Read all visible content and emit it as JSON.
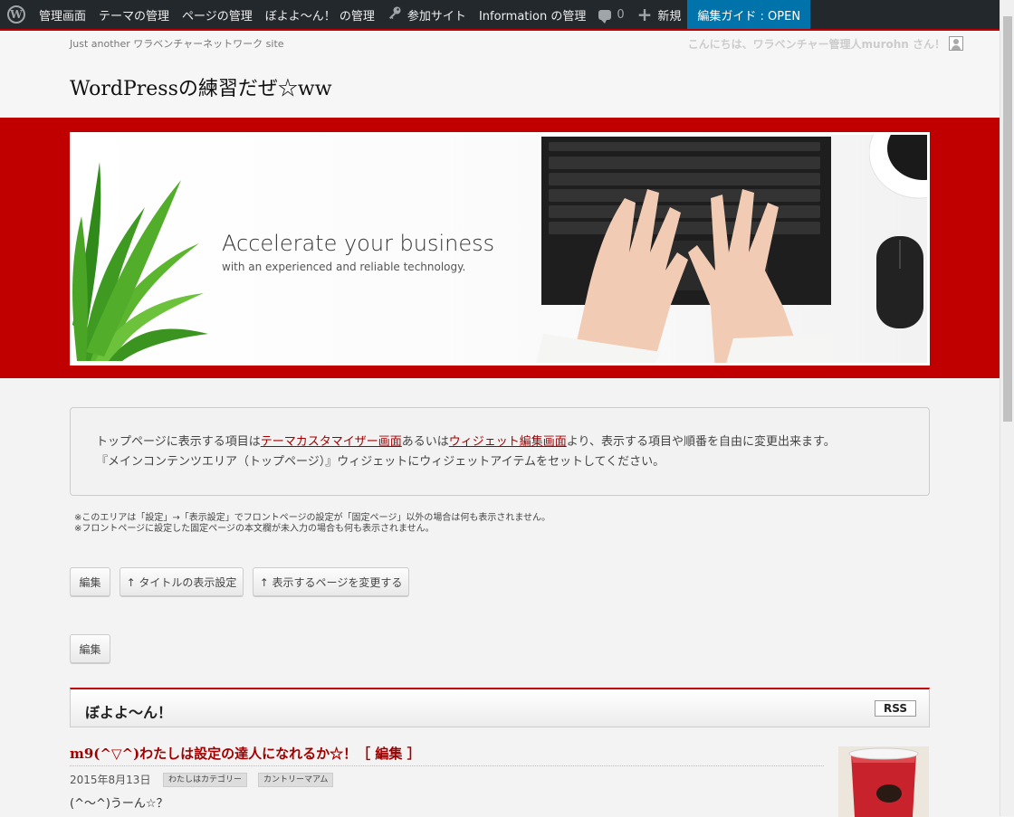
{
  "adminbar": {
    "items": [
      {
        "label": "管理画面",
        "icon": "dashboard-icon"
      },
      {
        "label": "テーマの管理"
      },
      {
        "label": "ページの管理"
      },
      {
        "label": "ぼよよ〜ん！ の管理"
      },
      {
        "label": "参加サイト",
        "icon": "key-icon"
      },
      {
        "label": "Information の管理"
      }
    ],
    "comments_count": "0",
    "new_label": "新規",
    "guide_label": "編集ガイド : OPEN"
  },
  "header": {
    "tagline": "Just another ワラベンチャーネットワーク site",
    "greeting": "こんにちは、ワラベンチャー管理人murohn さん！",
    "site_title": "WordPressの練習だぜ☆ww"
  },
  "banner": {
    "headline": "Accelerate your business",
    "subline": "with an experienced and reliable technology."
  },
  "notice": {
    "line1_pre": "トップページに表示する項目は",
    "link1": "テーマカスタマイザー画面",
    "line1_mid": "あるいは",
    "link2": "ウィジェット編集画面",
    "line1_post": "より、表示する項目や順番を自由に変更出来ます。",
    "line2": "『メインコンテンツエリア（トップページ）』ウィジェットにウィジェットアイテムをセットしてください。"
  },
  "small_note": {
    "line1": "※このエリアは「設定」→「表示設定」でフロントページの設定が「固定ページ」以外の場合は何も表示されません。",
    "line2": "※フロントページに設定した固定ページの本文欄が未入力の場合も何も表示されません。"
  },
  "buttons": {
    "edit1": "編集",
    "title_setting": "↑ タイトルの表示設定",
    "change_page": "↑ 表示するページを変更する",
    "edit2": "編集"
  },
  "widget": {
    "title": "ぼよよ〜ん！",
    "rss": "RSS"
  },
  "post": {
    "title": "m9(^▽^)わたしは設定の達人になれるか☆！［ 編集 ］",
    "date": "2015年8月13日",
    "tags": [
      "わたしはカテゴリー",
      "カントリーマアム"
    ],
    "excerpt": "(^〜^)うーん☆？"
  },
  "colors": {
    "accent": "#c00000",
    "adminbar_bg": "#23282d",
    "guide_bg": "#0073aa",
    "link": "#a00000"
  }
}
